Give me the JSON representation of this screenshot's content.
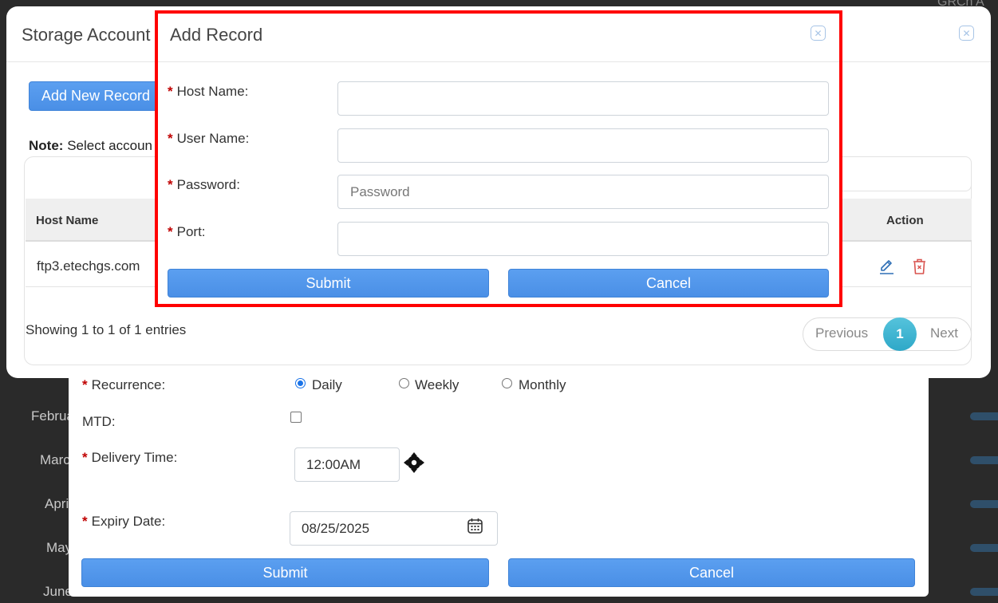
{
  "background": {
    "top_right_text": "GRCh A",
    "months": [
      "Februa",
      "Marc",
      "Apri",
      "May",
      "June"
    ]
  },
  "schedule_dialog": {
    "recurrence": {
      "label": "Recurrence:",
      "options": [
        {
          "label": "Daily",
          "selected": true
        },
        {
          "label": "Weekly",
          "selected": false
        },
        {
          "label": "Monthly",
          "selected": false
        }
      ]
    },
    "mtd": {
      "label": "MTD:",
      "checked": false
    },
    "delivery_time": {
      "label": "Delivery Time:",
      "value": "12:00AM"
    },
    "expiry_date": {
      "label": "Expiry Date:",
      "value": "08/25/2025"
    },
    "submit_label": "Submit",
    "cancel_label": "Cancel"
  },
  "storage_dialog": {
    "title": "Storage Account",
    "add_new_label": "Add New Record",
    "note_label": "Note:",
    "note_text": "Select accoun",
    "table": {
      "headers": {
        "host": "Host Name",
        "action": "Action"
      },
      "rows": [
        {
          "host": "ftp3.etechgs.com"
        }
      ]
    },
    "entries_text": "Showing 1 to 1 of 1 entries",
    "pagination": {
      "previous": "Previous",
      "current": "1",
      "next": "Next"
    }
  },
  "add_record_dialog": {
    "title": "Add Record",
    "fields": [
      {
        "label": "Host Name:",
        "placeholder": "",
        "value": ""
      },
      {
        "label": "User Name:",
        "placeholder": "",
        "value": ""
      },
      {
        "label": "Password:",
        "placeholder": "Password",
        "value": ""
      },
      {
        "label": "Port:",
        "placeholder": "",
        "value": ""
      }
    ],
    "submit_label": "Submit",
    "cancel_label": "Cancel"
  },
  "colors": {
    "primary_button": "#4a8fe6",
    "required_star": "#c00000",
    "highlight_border": "#ff0000",
    "page_active": "#2ea8c8",
    "delete_icon": "#d9534f",
    "edit_icon": "#2f6fb5"
  }
}
